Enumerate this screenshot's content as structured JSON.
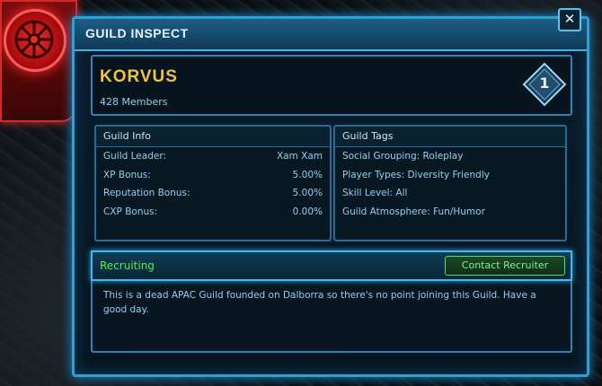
{
  "window": {
    "title": "GUILD INSPECT",
    "close_symbol": "✕"
  },
  "guild": {
    "name": "KORVUS",
    "members": "428 Members",
    "rank": "1"
  },
  "guild_info": {
    "header": "Guild Info",
    "rows": [
      {
        "label": "Guild Leader:",
        "value": "Xam Xam"
      },
      {
        "label": "XP Bonus:",
        "value": "5.00%"
      },
      {
        "label": "Reputation Bonus:",
        "value": "5.00%"
      },
      {
        "label": "CXP Bonus:",
        "value": "0.00%"
      }
    ]
  },
  "guild_tags": {
    "header": "Guild Tags",
    "rows": [
      "Social Grouping: Roleplay",
      "Player Types: Diversity Friendly",
      "Skill Level: All",
      "Guild Atmosphere: Fun/Humor"
    ]
  },
  "recruitment": {
    "status": "Recruiting",
    "button_label": "Contact Recruiter",
    "message": "This is a dead APAC Guild founded on Dalborra so there's no point joining this Guild. Have a good day."
  },
  "colors": {
    "frame_blue": "#2f9fd8",
    "guild_name_gold": "#f1c33a",
    "recruiting_green": "#4ef04e",
    "emblem_red": "#d22a2a"
  },
  "icons": [
    "faction-emblem-icon",
    "close-icon",
    "rank-diamond-icon"
  ]
}
